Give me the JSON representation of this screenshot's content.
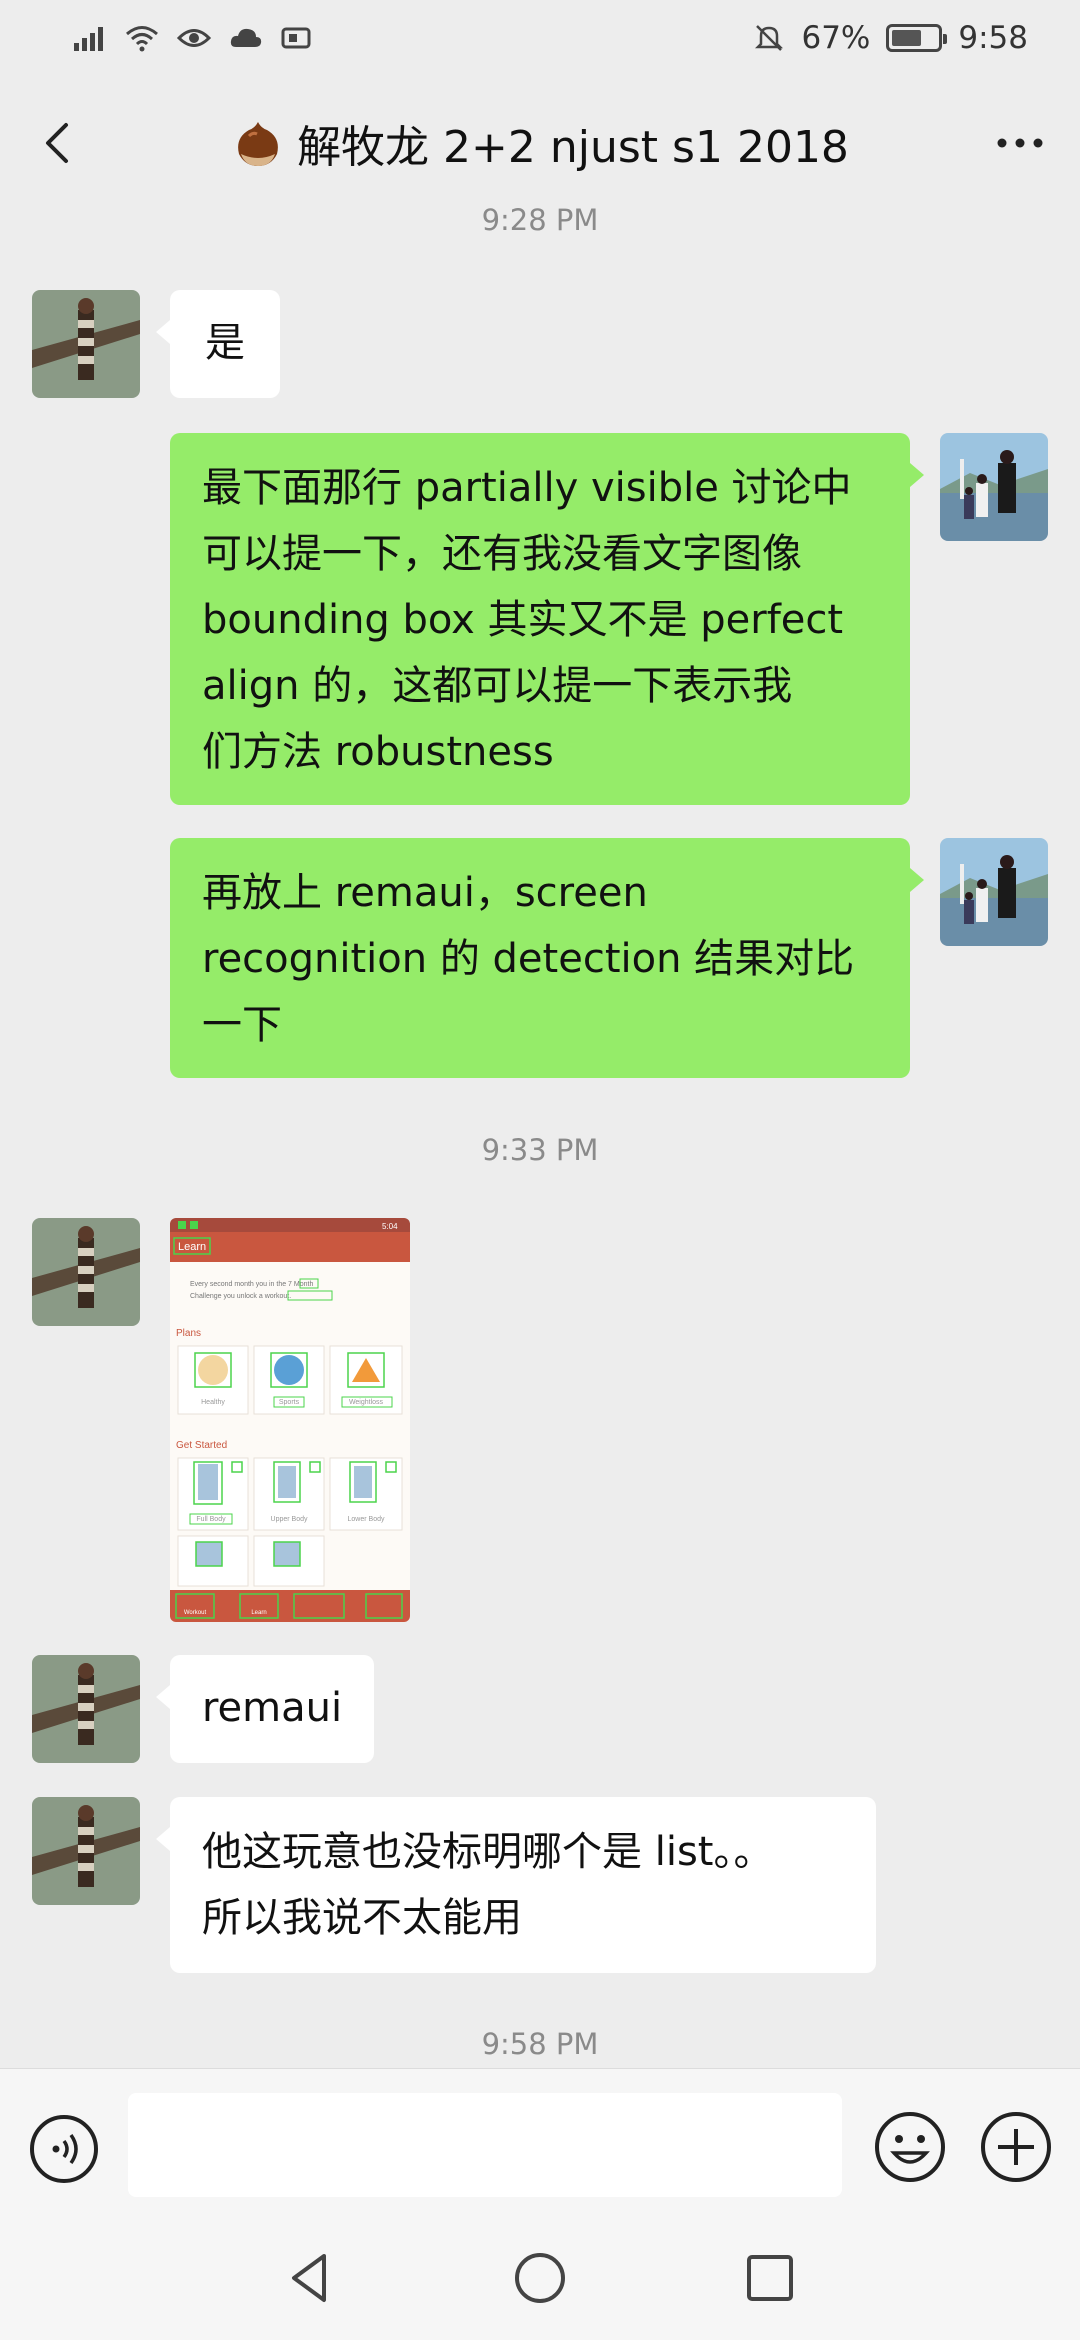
{
  "status_bar": {
    "battery_percent": "67%",
    "time": "9:58",
    "left_icons": [
      "signal-icon",
      "wifi-icon",
      "eye-icon",
      "cloud-icon",
      "notification-icon"
    ],
    "right_icons": [
      "mute-bell-icon",
      "battery-icon"
    ],
    "battery_level": 0.67
  },
  "header": {
    "title": "解牧龙 2+2 njust s1 2018",
    "title_icon": "chestnut-icon",
    "back_icon": "back-chevron-icon",
    "more_icon": "more-dots-icon"
  },
  "messages": [
    {
      "type": "time",
      "text": "9:28 PM"
    },
    {
      "type": "text",
      "side": "left",
      "avatar": "tree-avatar",
      "text": "是"
    },
    {
      "type": "text",
      "side": "right",
      "avatar": "family-avatar",
      "lines": [
        "最下面那行 partially visible 讨论中",
        "可以提一下，还有我没看文字图像",
        "bounding box 其实又不是 perfect",
        "align 的，这都可以提一下表示我",
        "们方法 robustness"
      ]
    },
    {
      "type": "text",
      "side": "right",
      "avatar": "family-avatar",
      "lines": [
        "再放上 remaui，screen",
        "recognition 的 detection 结果对比",
        "一下"
      ]
    },
    {
      "type": "time",
      "text": "9:33 PM"
    },
    {
      "type": "image",
      "side": "left",
      "avatar": "tree-avatar",
      "image": {
        "app_bar_title": "Learn",
        "status_time": "5:04",
        "intro_text": "Every second month you [ ] in the 7 Month Challenge you unlock a [ ] workout.",
        "section_plans": "Plans",
        "plans": [
          "Healthy",
          "Sports",
          "Weightloss"
        ],
        "section_get_started": "Get Started",
        "get_started": [
          "Full Body",
          "Upper Body",
          "Lower Body"
        ],
        "bottom_tabs": [
          "Workout",
          "Learn",
          "",
          ""
        ]
      }
    },
    {
      "type": "text",
      "side": "left",
      "avatar": "tree-avatar",
      "text": "remaui"
    },
    {
      "type": "text",
      "side": "left",
      "avatar": "tree-avatar",
      "lines": [
        "他这玩意也没标明哪个是 list。。",
        "所以我说不太能用"
      ]
    },
    {
      "type": "time",
      "text": "9:58 PM"
    }
  ],
  "input_bar": {
    "voice_icon": "voice-icon",
    "emoji_icon": "emoji-icon",
    "plus_icon": "plus-icon",
    "value": ""
  },
  "nav_bar": {
    "icons": [
      "nav-back-icon",
      "nav-home-icon",
      "nav-recent-icon"
    ]
  },
  "colors": {
    "background": "#ededed",
    "bubble_green": "#95ec69",
    "bubble_white": "#ffffff"
  }
}
